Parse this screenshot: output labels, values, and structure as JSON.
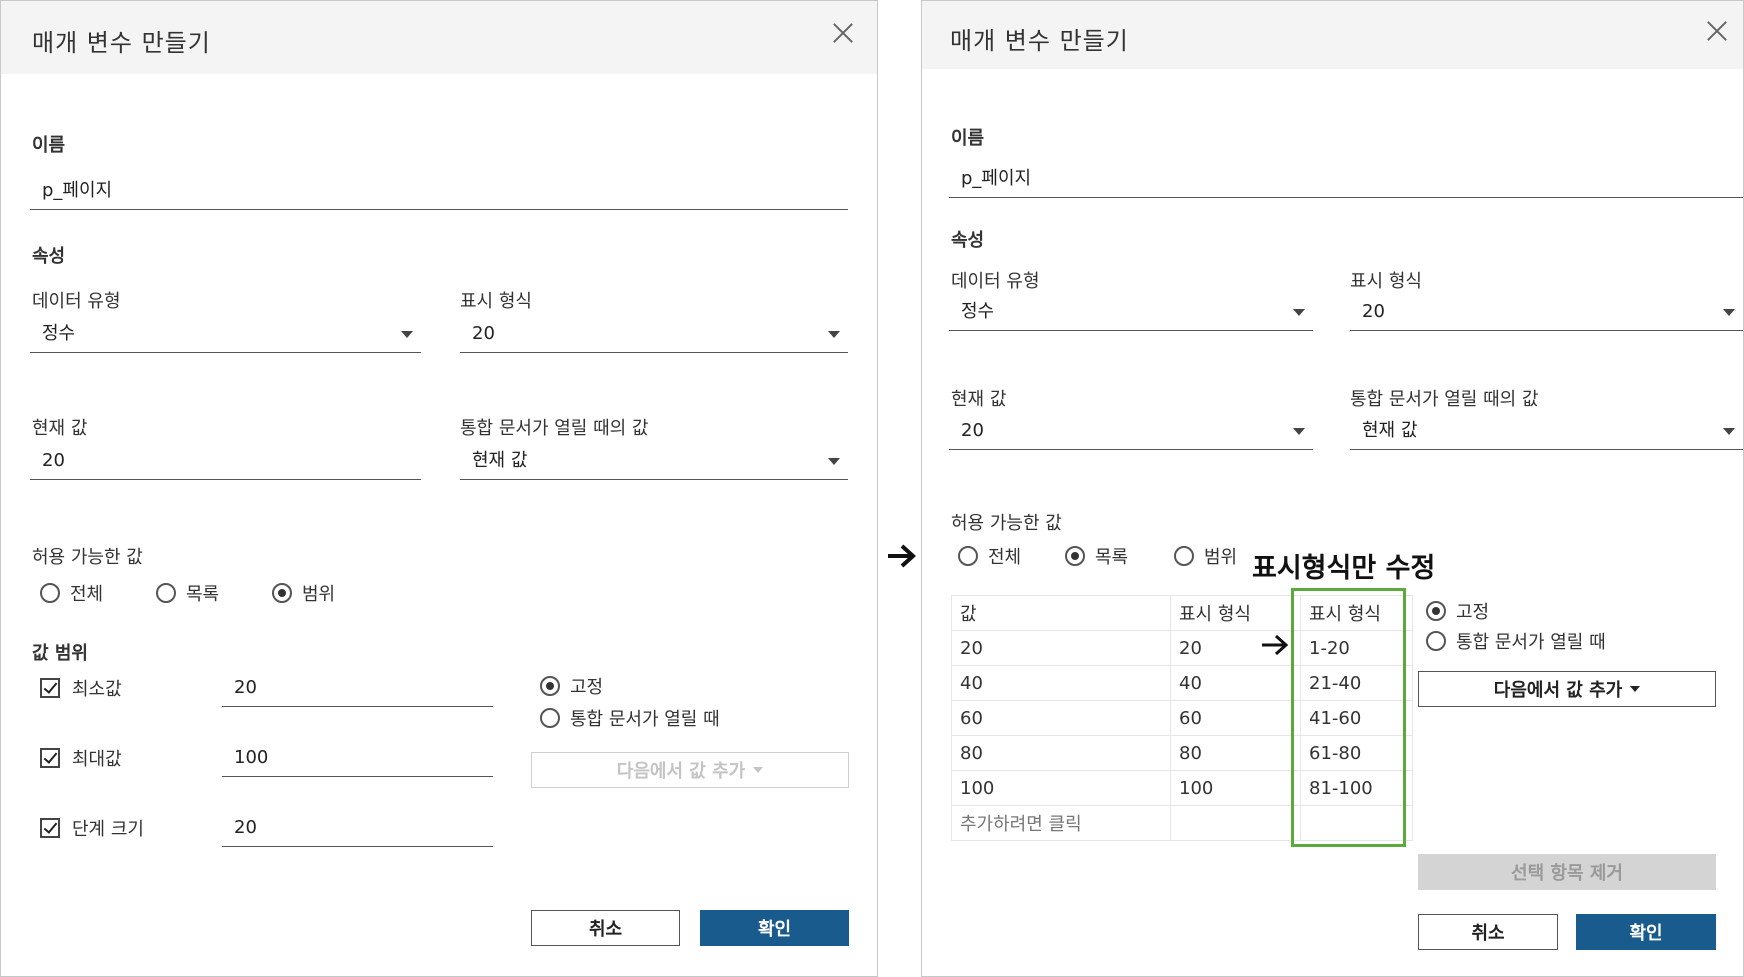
{
  "left_dialog": {
    "title": "매개 변수 만들기",
    "name_label": "이름",
    "name_value": "p_페이지",
    "properties_label": "속성",
    "data_type_label": "데이터 유형",
    "data_type_value": "정수",
    "display_format_label": "표시 형식",
    "display_format_value": "20",
    "current_value_label": "현재 값",
    "current_value": "20",
    "open_value_label": "통합 문서가 열릴 때의 값",
    "open_value": "현재 값",
    "allowable_label": "허용 가능한 값",
    "allowable_options": [
      "전체",
      "목록",
      "범위"
    ],
    "allowable_selected": "범위",
    "range_label": "값 범위",
    "min_label": "최소값",
    "min_value": "20",
    "max_label": "최대값",
    "max_value": "100",
    "step_label": "단계 크기",
    "step_value": "20",
    "fixed_label": "고정",
    "on_open_label": "통합 문서가 열릴 때",
    "fixed_selected": true,
    "add_from_label": "다음에서 값 추가",
    "cancel_label": "취소",
    "ok_label": "확인"
  },
  "right_dialog": {
    "title": "매개 변수 만들기",
    "name_label": "이름",
    "name_value": "p_페이지",
    "properties_label": "속성",
    "data_type_label": "데이터 유형",
    "data_type_value": "정수",
    "display_format_label": "표시 형식",
    "display_format_value": "20",
    "current_value_label": "현재 값",
    "current_value": "20",
    "open_value_label": "통합 문서가 열릴 때의 값",
    "open_value": "현재 값",
    "allowable_label": "허용 가능한 값",
    "allowable_options": [
      "전체",
      "목록",
      "범위"
    ],
    "allowable_selected": "목록",
    "table_headers": [
      "값",
      "표시 형식",
      "표시 형식"
    ],
    "table_rows": [
      [
        "20",
        "20",
        "1-20"
      ],
      [
        "40",
        "40",
        "21-40"
      ],
      [
        "60",
        "60",
        "41-60"
      ],
      [
        "80",
        "80",
        "61-80"
      ],
      [
        "100",
        "100",
        "81-100"
      ]
    ],
    "add_row_hint": "추가하려면 클릭",
    "fixed_label": "고정",
    "on_open_label": "통합 문서가 열릴 때",
    "add_from_label": "다음에서 값 추가",
    "remove_selected_label": "선택 항목 제거",
    "cancel_label": "취소",
    "ok_label": "확인"
  },
  "annotation": {
    "text": "표시형식만 수정",
    "highlight_color": "#5aaa3c"
  },
  "colors": {
    "primary_button": "#1a5b8e",
    "header_bg": "#f4f4f4"
  }
}
